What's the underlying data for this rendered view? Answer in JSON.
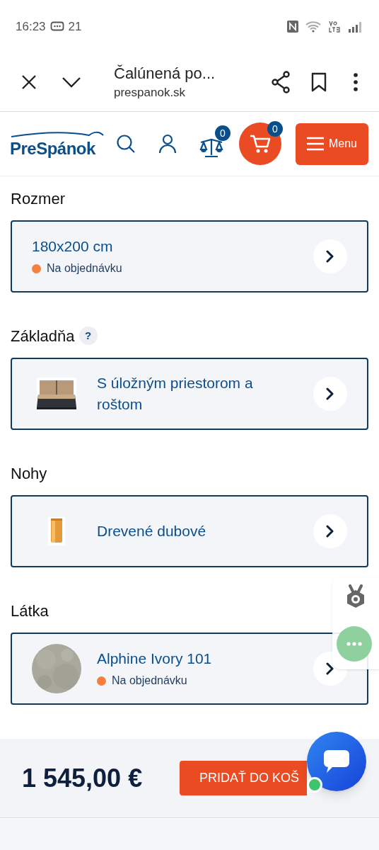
{
  "status_bar": {
    "time": "16:23",
    "notification_count": "21"
  },
  "browser_bar": {
    "title": "Čalúnená po...",
    "url": "prespanok.sk"
  },
  "header": {
    "logo": "PreSpánok",
    "compare_count": "0",
    "cart_count": "0",
    "menu_label": "Menu"
  },
  "sections": [
    {
      "label": "Rozmer",
      "option": {
        "kind": "text",
        "title": "180x200 cm",
        "status": "Na objednávku",
        "color": "#f5803e"
      }
    },
    {
      "label": "Základňa",
      "help": "?",
      "option": {
        "kind": "picture",
        "title": "S úložným priestorom a roštom"
      }
    },
    {
      "label": "Nohy",
      "option": {
        "kind": "picture",
        "title": "Drevené dubové"
      }
    },
    {
      "label": "Látka",
      "option": {
        "kind": "picture",
        "title": "Alphine Ivory 101",
        "status": "Na objednávku",
        "color": "#f5803e"
      }
    }
  ],
  "bottom_bar": {
    "price": "1 545,00 €",
    "add_button": "PRIDAŤ DO KOŠ"
  }
}
